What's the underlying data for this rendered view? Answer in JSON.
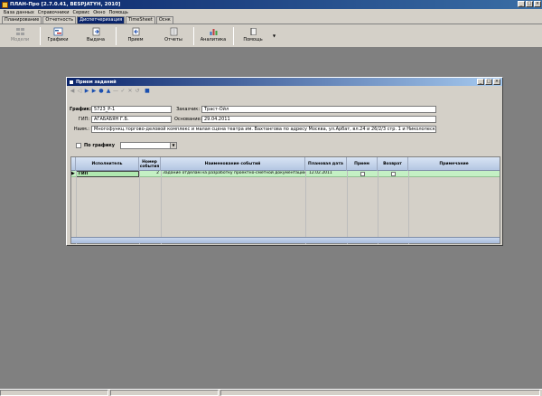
{
  "window": {
    "title": "ПЛАН-Про [2.7.0.41, BESPJATYH, 2010]",
    "controls": [
      "_",
      "□",
      "×"
    ]
  },
  "menu": [
    "База данных",
    "Справочники",
    "Сервис",
    "Окно",
    "Помощь"
  ],
  "tabs": [
    {
      "label": "Планирование",
      "active": false
    },
    {
      "label": "Отчетность",
      "active": false
    },
    {
      "label": "Диспетчеризация",
      "active": true
    },
    {
      "label": "TimeSheet",
      "active": false
    },
    {
      "label": "Оснк",
      "active": false
    }
  ],
  "toolbar": [
    {
      "label": "Модели",
      "icon": "model-icon",
      "enabled": false
    },
    {
      "label": "Графики",
      "icon": "schedule-icon",
      "enabled": true
    },
    {
      "label": "Выдача",
      "icon": "issue-icon",
      "enabled": true
    },
    {
      "label": "Прием",
      "icon": "receive-icon",
      "enabled": true
    },
    {
      "label": "Отчеты",
      "icon": "reports-icon",
      "enabled": true
    },
    {
      "label": "Аналитика",
      "icon": "analytics-icon",
      "enabled": true
    },
    {
      "label": "Помощь",
      "icon": "help-book-icon",
      "enabled": true
    }
  ],
  "dialog": {
    "title": "Прием заданий",
    "controls": [
      "_",
      "□",
      "×"
    ],
    "fields": {
      "schedule_label": "График:",
      "schedule_value": "5723_Р-1",
      "customer_label": "Заказчик:",
      "customer_value": "Траст-Ойл",
      "gip_label": "ГИП:",
      "gip_value": "АГАБАБЯН Г.Б.",
      "start_label": "Основание:",
      "start_value": "29.04.2011",
      "name_label": "Наим.:",
      "name_value": "Многофункц.торгово-деловой комплекс и малая сцена театра им. Вахтангова по адресу Москва, ул.Арбат, вл.24 и 26/2/3 стр. 1 и Николопесковский Бол"
    },
    "filter": {
      "label": "По графику",
      "checked": false
    },
    "grid": {
      "columns": [
        "Исполнитель",
        "Номер события",
        "Наименование событий",
        "Плановая дата",
        "Прием",
        "Возврат",
        "Примечание"
      ],
      "rows": [
        {
          "executor": "ГИП",
          "number": "2",
          "name": "Задание отделам на разработку проектно-сметной документации (ПСД)",
          "planned_date": "12.02.2011",
          "accepted": false,
          "returned": false,
          "note": ""
        }
      ]
    }
  },
  "colors": {
    "title_bar": "#0a246a",
    "row_highlight": "#c4f0c4",
    "desktop": "#808080"
  }
}
